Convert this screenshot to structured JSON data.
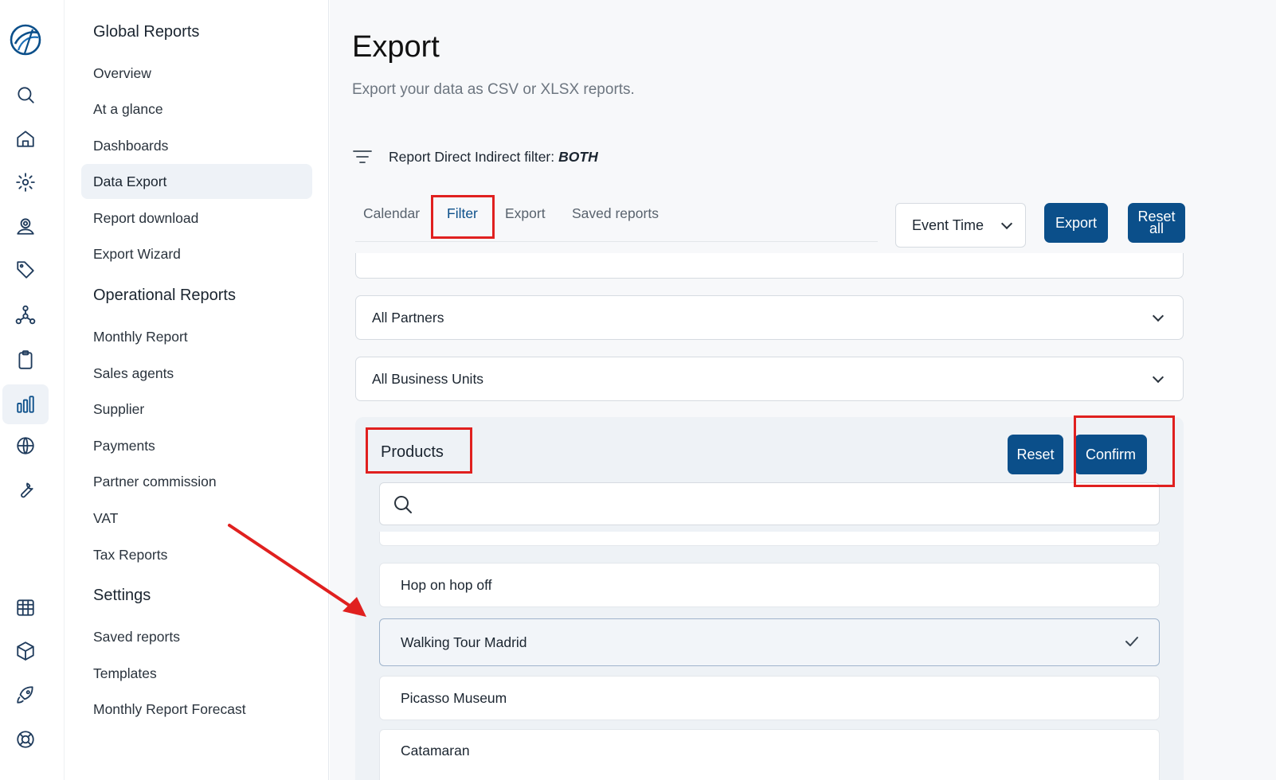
{
  "rail": {
    "icons": [
      "logo-icon",
      "search-icon",
      "home-icon",
      "gear-icon",
      "user-pin-icon",
      "tag-icon",
      "network-icon",
      "clipboard-icon",
      "bar-chart-icon",
      "globe-icon",
      "wrench-icon",
      "calendar-grid-icon",
      "cube-icon",
      "rocket-icon",
      "lifebuoy-icon"
    ],
    "active": "bar-chart-icon"
  },
  "sidebar": {
    "sections": [
      {
        "title": "Global Reports",
        "items": [
          "Overview",
          "At a glance",
          "Dashboards",
          "Data Export",
          "Report download",
          "Export Wizard"
        ]
      },
      {
        "title": "Operational Reports",
        "items": [
          "Monthly Report",
          "Sales agents",
          "Supplier",
          "Payments",
          "Partner commission",
          "VAT",
          "Tax Reports"
        ]
      },
      {
        "title": "Settings",
        "items": [
          "Saved reports",
          "Templates",
          "Monthly Report Forecast"
        ]
      }
    ],
    "active_item": "Data Export"
  },
  "page": {
    "title": "Export",
    "subtitle": "Export your data as CSV or XLSX reports.",
    "filter_label": "Report Direct Indirect filter:",
    "filter_value": "BOTH"
  },
  "tabs": [
    "Calendar",
    "Filter",
    "Export",
    "Saved reports"
  ],
  "active_tab": "Filter",
  "toolbar": {
    "time_select": "Event Time",
    "export_label": "Export",
    "reset_all_line1": "Reset",
    "reset_all_line2": "all"
  },
  "filters": {
    "partners": "All Partners",
    "business_units": "All Business Units"
  },
  "products": {
    "title": "Products",
    "reset_label": "Reset",
    "confirm_label": "Confirm",
    "search_placeholder": "",
    "items": [
      {
        "label": "Hop on hop off",
        "selected": false
      },
      {
        "label": "Walking Tour Madrid",
        "selected": true
      },
      {
        "label": "Picasso Museum",
        "selected": false
      },
      {
        "label": "Catamaran",
        "selected": false
      }
    ]
  },
  "colors": {
    "accent": "#0b4f8a",
    "annotation": "#e0201f"
  }
}
